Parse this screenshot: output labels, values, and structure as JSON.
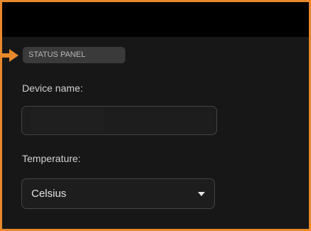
{
  "header": {
    "tag_label": "STATUS PANEL"
  },
  "form": {
    "device_name": {
      "label": "Device name:",
      "value": "",
      "placeholder": ""
    },
    "temperature": {
      "label": "Temperature:",
      "selected": "Celsius"
    }
  },
  "colors": {
    "accent": "#e8892b",
    "background": "#171717",
    "topbar": "#000000",
    "field_border": "#444444"
  },
  "icons": {
    "pointer": "arrow-right-icon",
    "dropdown": "chevron-down-icon"
  }
}
